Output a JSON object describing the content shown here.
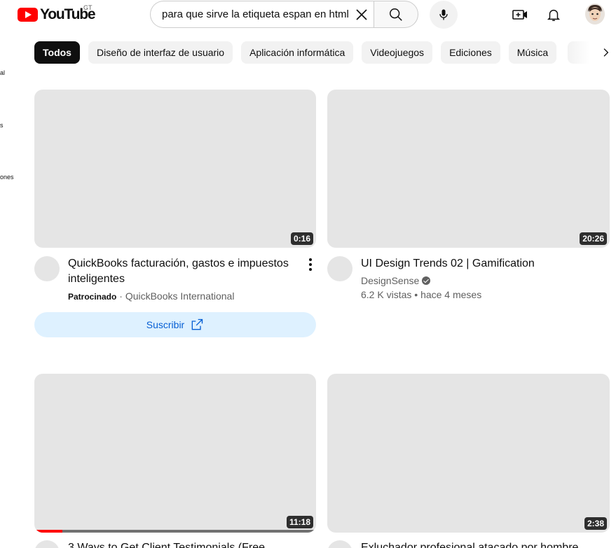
{
  "header": {
    "logo_text": "YouTube",
    "country_code": "GT",
    "search_value": "para que sirve la etiqueta espan en html",
    "icons": [
      "youtube-logo-icon",
      "clear-icon",
      "search-icon",
      "mic-icon",
      "create-video-icon",
      "bell-icon"
    ]
  },
  "sidebar": {
    "fragments": [
      "al",
      "s",
      "ones"
    ]
  },
  "chips": [
    {
      "label": "Todos",
      "active": true
    },
    {
      "label": "Diseño de interfaz de usuario"
    },
    {
      "label": "Aplicación informática"
    },
    {
      "label": "Videojuegos"
    },
    {
      "label": "Ediciones"
    },
    {
      "label": "Música"
    }
  ],
  "videos": [
    {
      "title": "QuickBooks facturación, gastos e impuestos inteligentes",
      "duration": "0:16",
      "sponsored_label": "Patrocinado",
      "channel": "QuickBooks International",
      "subscribe_label": "Suscribir"
    },
    {
      "title": "UI Design Trends 02 | Gamification",
      "duration": "20:26",
      "channel": "DesignSense",
      "verified": true,
      "views": "6.2 K vistas",
      "age": "hace 4 meses"
    },
    {
      "title": "3 Ways to Get Client Testimonials (Free",
      "duration": "11:18",
      "watched_fraction": 0.1
    },
    {
      "title": "Exluchador profesional atacado por hombre",
      "duration": "2:38"
    }
  ],
  "colors": {
    "brand_red": "#ff0000",
    "chip_bg": "#f2f2f2",
    "subscribe_bg": "#def1ff",
    "subscribe_text": "#065fd4",
    "placeholder_gray": "#e5e5e5"
  }
}
